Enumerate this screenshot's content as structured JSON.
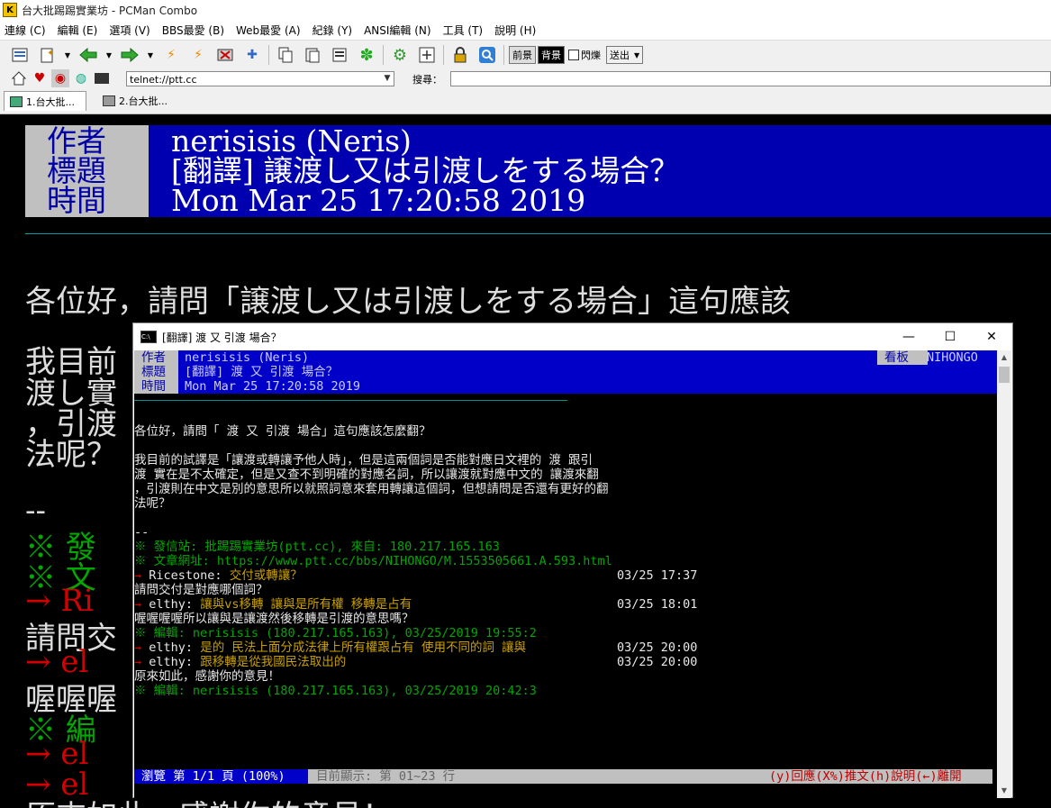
{
  "window": {
    "title": "台大批踢踢實業坊 - PCMan Combo"
  },
  "menu": [
    "連線 (C)",
    "編輯 (E)",
    "選項 (V)",
    "BBS最愛 (B)",
    "Web最愛 (A)",
    "紀錄 (Y)",
    "ANSI編輯 (N)",
    "工具 (T)",
    "說明 (H)"
  ],
  "toolbar": {
    "fg_label": "前景",
    "bg_label": "背景",
    "blink_label": "閃爍",
    "send_label": "送出"
  },
  "address": {
    "value": "telnet://ptt.cc"
  },
  "search": {
    "label": "搜尋：",
    "value": ""
  },
  "tabs": [
    {
      "label": "1.台大批..."
    },
    {
      "label": "2.台大批..."
    }
  ],
  "article": {
    "author_label": "作者",
    "author": "nerisisis (Neris)",
    "title_label": "標題",
    "title": "[翻譯] 譲渡し又は引渡しをする場合？",
    "time_label": "時間",
    "time": "Mon Mar 25 17:20:58 2019",
    "bg_lines": [
      "各位好，請問「譲渡し又は引渡しをする場合」這句應該",
      "我目前",
      "渡し實",
      "，引渡",
      "法呢？",
      "--",
      "※ 發",
      "※ 文",
      "→ Ri",
      "請問交",
      "→ el",
      "喔喔喔",
      "※ 編",
      "→ el",
      "→ el",
      "原來如此，感謝你的意見！"
    ]
  },
  "telnet": {
    "title": "[翻譯]   渡 又 引渡       場合？",
    "author_label": "作者",
    "author": "nerisisis (Neris)",
    "title_label": "標題",
    "time_label": "時間",
    "time": "Mon Mar 25 17:20:58 2019",
    "board_label": "看板",
    "board": "NIHONGO",
    "body": [
      "各位好，請問「  渡 又 引渡       場合」這句應該怎麼翻？",
      "我目前的試譯是「讓渡或轉讓予他人時」，但是這兩個詞是否能對應日文裡的  渡 跟引",
      "渡  實在是不太確定，但是又查不到明確的對應名詞，所以讓渡就對應中文的 讓渡來翻",
      "，引渡則在中文是別的意思所以就照詞意來套用轉讓這個詞，但想請問是否還有更好的翻",
      "法呢？",
      "--"
    ],
    "sig1": "※ 發信站: 批踢踢實業坊(ptt.cc), 來自: 180.217.165.163",
    "sig2": "※ 文章網址: https://www.ptt.cc/bbs/NIHONGO/M.1553505661.A.593.html",
    "c1_arrow": "→",
    "c1_user": "Ricestone:",
    "c1_text": "交付或轉讓？",
    "c1_time": "03/25 17:37",
    "reply1": "請問交付是對應哪個詞？",
    "c2_arrow": "→",
    "c2_user": "elthy:",
    "c2_text": "讓與vs移轉 讓與是所有權 移轉是占有",
    "c2_time": "03/25 18:01",
    "reply2": "喔喔喔喔所以讓與是讓渡然後移轉是引渡的意思嗎？",
    "edit1": "※ 編輯: nerisisis (180.217.165.163), 03/25/2019 19:55:2",
    "c3_arrow": "→",
    "c3_user": "elthy:",
    "c3_text": "是的 民法上面分成法律上所有權跟占有 使用不同的詞 讓與",
    "c3_time": "03/25 20:00",
    "c4_arrow": "→",
    "c4_user": "elthy:",
    "c4_text": "跟移轉是從我國民法取出的",
    "c4_time": "03/25 20:00",
    "reply3": "原來如此，感謝你的意見！",
    "edit2": "※ 編輯: nerisisis (180.217.165.163), 03/25/2019 20:42:3",
    "status_left": "瀏覽 第 1/1 頁 (100%)",
    "status_mid": "目前顯示: 第 01~23 行",
    "status_right": "(y)回應(X%)推文(h)說明(←)離開"
  }
}
